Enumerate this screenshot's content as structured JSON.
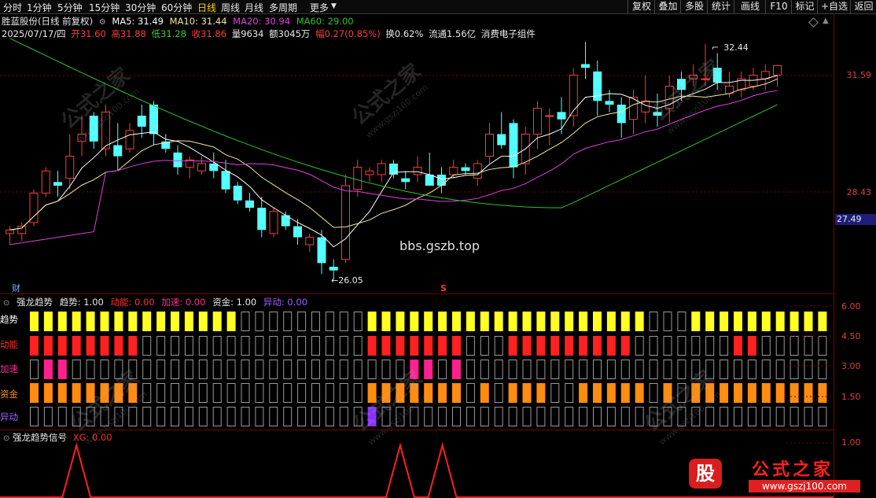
{
  "toolbar": {
    "tabs": [
      "分时",
      "1分钟",
      "5分钟",
      "15分钟",
      "30分钟",
      "60分钟",
      "日线",
      "周线",
      "月线",
      "多周期",
      "更多"
    ],
    "active_tab": "日线",
    "right_buttons": [
      "复权",
      "叠加",
      "多股",
      "统计",
      "画线",
      "F10",
      "标记",
      "+自选",
      "返回"
    ]
  },
  "stock": {
    "title": "胜蓝股份(日线 前复权)",
    "ma5": "MA5: 31.49",
    "ma10": "MA10: 31.44",
    "ma20": "MA20: 30.94",
    "ma60": "MA60: 29.00",
    "date": "2025/07/17/四",
    "open_label": "开",
    "open": "31.60",
    "high_label": "高",
    "high": "31.88",
    "low_label": "低",
    "low": "31.28",
    "close_label": "收",
    "close": "31.86",
    "volume": "量9634",
    "amount": "额3045万",
    "change": "幅0.27(0.85%)",
    "turnover": "换0.62%",
    "float_cap": "流通1.56亿",
    "sector": "消费电子组件"
  },
  "price_axis": {
    "p1": "31.59",
    "p2": "28.43",
    "current": "27.49"
  },
  "annotations": {
    "high_mark": "32.44",
    "low_mark": "26.05",
    "cai": "财",
    "s": "S"
  },
  "colors": {
    "up": "#ff3b3b",
    "down": "#54ffff",
    "ma5": "#ffffff",
    "ma10": "#f4e7a0",
    "ma20": "#e040e0",
    "ma60": "#30c030",
    "trend": "#ffff22",
    "power": "#ff2020",
    "accel": "#ff2090",
    "fund": "#ff8c10",
    "abn": "#8a30ff"
  },
  "indicator1": {
    "name": "强龙趋势",
    "trend": "趋势: 1.00",
    "power": "动能: 0.00",
    "accel": "加速: 0.00",
    "fund": "资金: 1.00",
    "abn": "异动: 0.00",
    "rows": [
      "趋势",
      "动能",
      "加速",
      "资金",
      "异动"
    ],
    "axis": [
      "6.00",
      "4.50",
      "3.00",
      "1.50"
    ]
  },
  "indicator2": {
    "name": "强龙趋势信号",
    "xg": "XG: 0.00",
    "axis": "1.00"
  },
  "watermark": {
    "text": "公式之家",
    "sub": "www.gszj100.com",
    "url": "bbs.gszb.top"
  },
  "logo": {
    "icon": "股",
    "title": "公式之家",
    "sub": "www.gszj100.com"
  },
  "chart_data": {
    "type": "candlestick",
    "candles_ohlc": [
      [
        27.3,
        27.5,
        27.0,
        27.4
      ],
      [
        27.3,
        27.6,
        27.1,
        27.5
      ],
      [
        27.6,
        28.5,
        27.5,
        28.4
      ],
      [
        28.4,
        29.1,
        28.3,
        29.0
      ],
      [
        28.7,
        29.0,
        28.3,
        28.6
      ],
      [
        28.8,
        30.0,
        28.5,
        29.4
      ],
      [
        29.8,
        30.5,
        29.4,
        30.0
      ],
      [
        30.5,
        30.6,
        29.6,
        29.8
      ],
      [
        29.6,
        30.8,
        29.4,
        30.6
      ],
      [
        29.7,
        30.3,
        29.0,
        29.4
      ],
      [
        29.6,
        30.3,
        29.5,
        30.1
      ],
      [
        30.5,
        30.8,
        29.9,
        30.2
      ],
      [
        30.8,
        30.9,
        29.7,
        30.0
      ],
      [
        29.8,
        30.0,
        29.5,
        29.6
      ],
      [
        29.5,
        29.7,
        28.9,
        29.1
      ],
      [
        29.1,
        29.4,
        28.8,
        29.3
      ],
      [
        29.0,
        29.4,
        28.9,
        29.2
      ],
      [
        29.2,
        29.5,
        28.8,
        29.0
      ],
      [
        29.0,
        29.3,
        28.4,
        28.5
      ],
      [
        28.6,
        28.7,
        28.1,
        28.2
      ],
      [
        28.2,
        28.4,
        27.9,
        28.0
      ],
      [
        28.0,
        28.3,
        27.2,
        27.4
      ],
      [
        27.3,
        28.0,
        27.2,
        27.9
      ],
      [
        27.8,
        27.9,
        27.4,
        27.5
      ],
      [
        27.5,
        27.7,
        27.0,
        27.2
      ],
      [
        27.0,
        27.3,
        26.8,
        27.2
      ],
      [
        27.2,
        27.4,
        26.2,
        26.5
      ],
      [
        26.4,
        26.6,
        26.05,
        26.3
      ],
      [
        26.6,
        28.9,
        26.5,
        28.6
      ],
      [
        28.5,
        29.3,
        28.3,
        29.1
      ],
      [
        28.9,
        29.1,
        28.7,
        29.0
      ],
      [
        28.9,
        29.3,
        28.7,
        29.2
      ],
      [
        29.2,
        29.3,
        28.8,
        28.9
      ],
      [
        28.8,
        29.0,
        28.5,
        28.7
      ],
      [
        28.9,
        29.4,
        28.7,
        29.1
      ],
      [
        28.9,
        29.5,
        28.6,
        28.6
      ],
      [
        28.9,
        29.1,
        28.4,
        28.6
      ],
      [
        28.9,
        29.3,
        28.8,
        29.1
      ],
      [
        29.1,
        29.2,
        28.9,
        29.0
      ],
      [
        28.8,
        29.3,
        28.6,
        29.2
      ],
      [
        29.4,
        30.3,
        29.2,
        30.0
      ],
      [
        30.0,
        30.6,
        29.6,
        29.7
      ],
      [
        30.3,
        30.4,
        28.8,
        29.1
      ],
      [
        29.2,
        30.2,
        28.9,
        30.0
      ],
      [
        30.0,
        30.9,
        29.6,
        30.7
      ],
      [
        30.5,
        30.7,
        29.7,
        30.5
      ],
      [
        30.6,
        31.0,
        30.0,
        30.4
      ],
      [
        30.5,
        31.8,
        30.2,
        31.6
      ],
      [
        31.9,
        32.5,
        31.5,
        31.8
      ],
      [
        31.7,
        32.0,
        30.5,
        30.9
      ],
      [
        30.9,
        31.2,
        30.6,
        30.8
      ],
      [
        30.8,
        31.0,
        29.9,
        30.3
      ],
      [
        30.4,
        31.2,
        30.0,
        31.0
      ],
      [
        30.6,
        31.6,
        30.3,
        30.9
      ],
      [
        30.6,
        31.1,
        30.2,
        30.5
      ],
      [
        30.7,
        31.6,
        30.3,
        31.3
      ],
      [
        31.5,
        31.7,
        30.9,
        31.2
      ],
      [
        31.5,
        31.9,
        31.3,
        31.6
      ],
      [
        31.5,
        32.44,
        31.3,
        31.5
      ],
      [
        31.8,
        32.2,
        31.2,
        31.4
      ],
      [
        31.1,
        31.7,
        31.0,
        31.3
      ],
      [
        31.2,
        31.7,
        31.0,
        31.5
      ],
      [
        31.3,
        31.8,
        31.2,
        31.6
      ],
      [
        31.5,
        31.9,
        31.2,
        31.7
      ],
      [
        31.6,
        31.88,
        31.28,
        31.86
      ]
    ],
    "indicator_rows": {
      "trend": [
        1,
        1,
        1,
        1,
        1,
        1,
        1,
        1,
        1,
        1,
        1,
        1,
        1,
        1,
        1,
        0,
        0,
        0,
        0,
        0,
        0,
        0,
        0,
        0,
        1,
        1,
        1,
        1,
        1,
        1,
        1,
        1,
        1,
        1,
        1,
        1,
        1,
        1,
        1,
        1,
        1,
        1,
        1,
        1,
        0,
        0,
        0,
        1,
        1,
        1,
        1,
        1,
        1,
        1,
        1,
        1,
        1
      ],
      "power": [
        1,
        1,
        1,
        1,
        1,
        1,
        1,
        1,
        0,
        0,
        0,
        0,
        0,
        0,
        0,
        0,
        0,
        0,
        0,
        0,
        0,
        0,
        0,
        0,
        1,
        1,
        1,
        1,
        1,
        1,
        1,
        0,
        0,
        0,
        1,
        1,
        1,
        1,
        1,
        1,
        1,
        1,
        1,
        0,
        0,
        0,
        0,
        0,
        0,
        0,
        1,
        1,
        0,
        0,
        0,
        0,
        0
      ],
      "accel": [
        0,
        1,
        1,
        0,
        0,
        0,
        0,
        0,
        0,
        0,
        0,
        0,
        0,
        0,
        0,
        0,
        0,
        0,
        0,
        0,
        0,
        0,
        0,
        0,
        0,
        0,
        0,
        1,
        1,
        0,
        1,
        0,
        0,
        0,
        0,
        0,
        0,
        0,
        0,
        0,
        0,
        0,
        0,
        0,
        0,
        0,
        0,
        0,
        0,
        0,
        0,
        0,
        0,
        0,
        0,
        0,
        0
      ],
      "fund": [
        1,
        1,
        1,
        1,
        1,
        1,
        1,
        1,
        0,
        0,
        0,
        0,
        0,
        0,
        0,
        0,
        0,
        0,
        0,
        0,
        0,
        0,
        0,
        0,
        1,
        1,
        1,
        1,
        1,
        1,
        1,
        0,
        1,
        0,
        1,
        1,
        1,
        0,
        0,
        1,
        1,
        1,
        1,
        1,
        0,
        1,
        0,
        1,
        1,
        1,
        1,
        1,
        1,
        1,
        1,
        1,
        1
      ],
      "abn": [
        0,
        0,
        0,
        0,
        0,
        0,
        0,
        0,
        0,
        0,
        0,
        0,
        0,
        0,
        0,
        0,
        0,
        0,
        0,
        0,
        0,
        0,
        0,
        0,
        1,
        0,
        0,
        0,
        0,
        0,
        0,
        0,
        0,
        0,
        0,
        0,
        0,
        0,
        0,
        0,
        0,
        0,
        0,
        0,
        0,
        0,
        0,
        0,
        0,
        0,
        0,
        0,
        0,
        0,
        0,
        0,
        0
      ]
    },
    "xg_signal": [
      0,
      0,
      0,
      1,
      0,
      0,
      0,
      0,
      0,
      0,
      0,
      0,
      0,
      0,
      0,
      0,
      0,
      0,
      0,
      0,
      0,
      0,
      0,
      0,
      0,
      0,
      1,
      0,
      0,
      1,
      0,
      0,
      0,
      0,
      0,
      0,
      0,
      0,
      0,
      0,
      0,
      0,
      0,
      0,
      0,
      0,
      0,
      0,
      0,
      0,
      0,
      0,
      0,
      0,
      0,
      0,
      0
    ],
    "ylim": [
      25.6,
      33.2
    ],
    "ytick_labels": [
      "31.59",
      "28.43"
    ]
  }
}
